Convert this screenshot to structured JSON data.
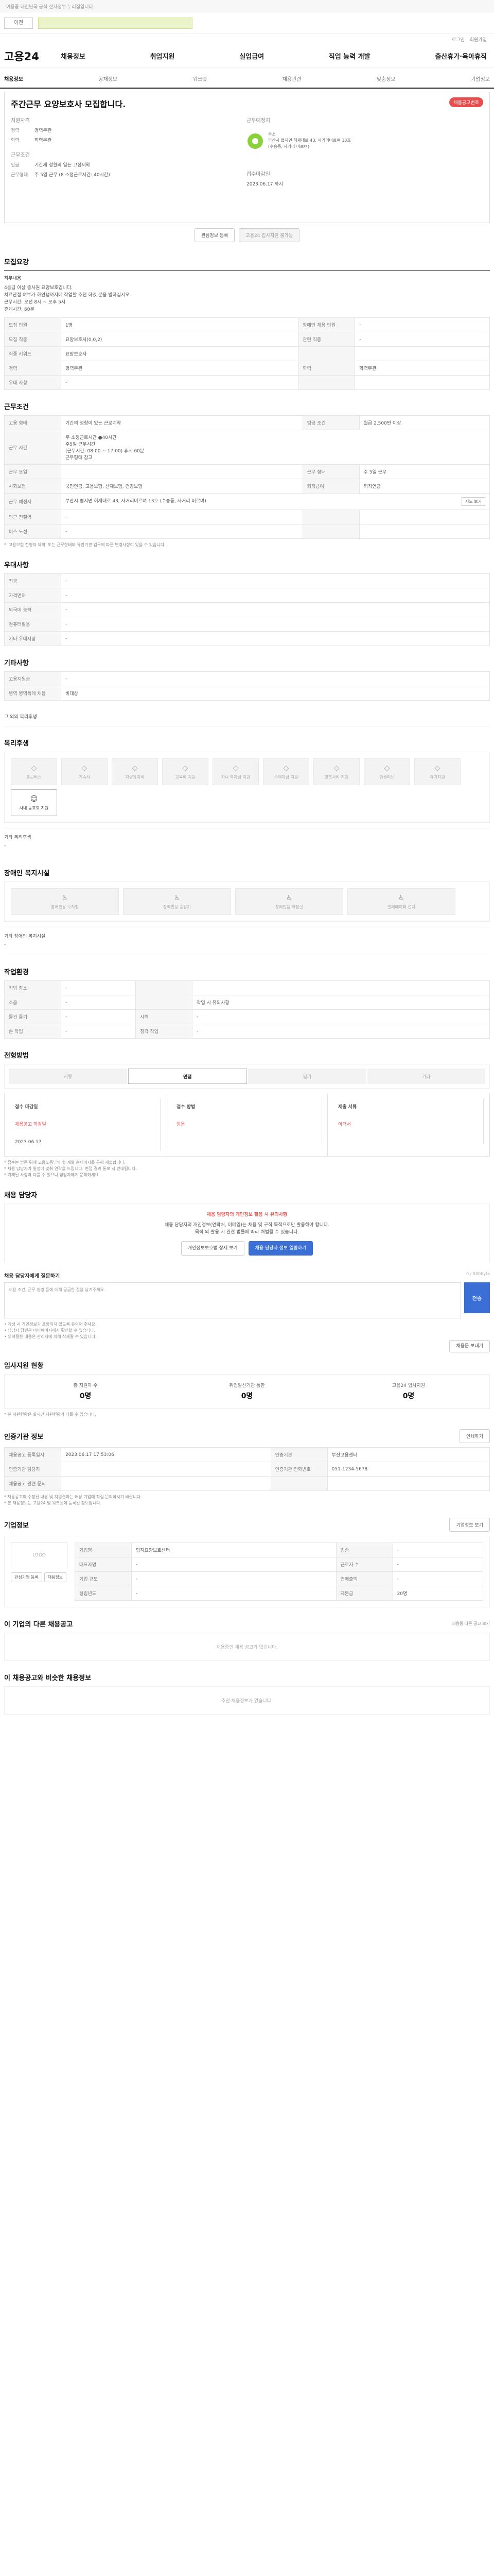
{
  "topbar": {
    "notice": "이용중 대한민국 공식 전자정부 누리집입니다."
  },
  "search": {
    "prev_label": "이전",
    "next_label": "다음"
  },
  "util": [
    "로그인",
    "회원가입"
  ],
  "brand": {
    "logo": "고용24"
  },
  "gnb": [
    "채용정보",
    "취업지원",
    "실업급여",
    "직업 능력 개발",
    "출산휴가·육아휴직"
  ],
  "lnb": [
    "채용정보",
    "공채정보",
    "워크넷",
    "채용관련",
    "맞춤정보",
    "기업정보"
  ],
  "summary": {
    "title": "주간근무 요양보호사 모집합니다.",
    "badge": "채용공고번호",
    "qual_h": "지원자격",
    "career_k": "경력",
    "career_v": "경력무관",
    "edu_k": "학력",
    "edu_v": "학력무관",
    "cond_h": "근무조건",
    "wage_k": "임금",
    "wage_v": "기간제 정월의 일는 고정제약",
    "hours_k": "근무형태",
    "hours_v": "주 5일 근무 (8 소정근로시간: 40시간)",
    "place_h": "근무예정지",
    "place_line1": "주소",
    "place_line2": "부산시 협지면 허제대로 43, 사거리버르며 13호",
    "place_line3": "(수송동, 사거리 버르며)",
    "period_h": "접수마감일",
    "period_v": "2023.06.17 까지"
  },
  "actions": {
    "interest": "관심정보 등록",
    "apply": "고용24 입사지원 불가능"
  },
  "recruit": {
    "h": "모집요강",
    "desc_title": "직무내용",
    "desc_lines": [
      "4등급 이상 종사원 요양보호입니다.",
      "치료단절 여부가 하얀탭까지에 작업할 추천 하였 분을 별하십시오.",
      "근무시간: 오전 8시 ~ 오후 5시",
      "휴게시간: 60분"
    ],
    "rows": [
      [
        "모집 인원",
        "1명",
        "장애인 채용 인원",
        "-"
      ],
      [
        "모집 직종",
        "요양보호사(0,0,2)",
        "관련 직종",
        "-"
      ],
      [
        "직종 키워드",
        "요양보호사",
        "",
        ""
      ],
      [
        "경력",
        "경력무관",
        "학력",
        "학력무관"
      ],
      [
        "우대 사항",
        "-",
        "",
        ""
      ]
    ]
  },
  "work": {
    "h": "근무조건",
    "rows": [
      [
        "고용 형태",
        "기간의 정함이 있는 근로계약",
        "임금 조건",
        "월급 2,500만 이상"
      ],
      [
        "근무 시간",
        "주 소정근로시간 ●40시간",
        "",
        ""
      ],
      [
        "근무 요일",
        "",
        "근무 형태",
        "주 5일 근무"
      ],
      [
        "사회보험",
        "국민연금, 고용보험, 산재보험, 건강보험",
        "퇴직급여",
        "퇴직연금"
      ],
      [
        "근무 예정지",
        "부산시 협지면 허제대로 43, 사거리버르며 13호 (수송동, 사거리 버르며)",
        "",
        ""
      ],
      [
        "인근 전철역",
        "-",
        "",
        ""
      ],
      [
        "버스 노선",
        "-",
        "",
        ""
      ]
    ],
    "time_lines": [
      "주5일 근무시간",
      "(근무시간: 08:00 ~ 17:00) 휴게 60분",
      "근무형태 참고"
    ],
    "map_btn": "지도 보기",
    "note": "* '고용보험 전형자 제외' 또는 근무형태와 유관기관 업무에 따른 변경사항이 있을 수 있습니다."
  },
  "pref": {
    "h": "우대사항",
    "rows": [
      [
        "전공",
        "-"
      ],
      [
        "자격면허",
        "-"
      ],
      [
        "외국어 능력",
        "-"
      ],
      [
        "컴퓨터활용",
        "-"
      ],
      [
        "기타 우대사항",
        "-"
      ]
    ]
  },
  "etc": {
    "h": "기타사항",
    "rows": [
      [
        "고용지원금",
        "-"
      ],
      [
        "병역 병역특례 채용",
        "비대상"
      ]
    ],
    "link": "그 외의 복리후생"
  },
  "welfare": {
    "h": "복리후생",
    "items": [
      "통근버스",
      "기숙사",
      "차량유지비",
      "교육비 지원",
      "자녀 학자금 지원",
      "주택자금 지원",
      "경조사비 지원",
      "인센티브",
      "휴가지원"
    ],
    "active": "사내 동호회 지원",
    "sub_h": "기타 복리후생",
    "sub_v": "-"
  },
  "disab": {
    "h": "장애인 복지시설",
    "items": [
      "장애인용 주차장",
      "장애인용 승강기",
      "장애인용 화장실",
      "엘레베이터 설치"
    ],
    "sub_h": "기타 장애인 복지시설",
    "sub_v": "-"
  },
  "env": {
    "h": "작업환경",
    "rows": [
      [
        "작업 장소",
        "-",
        "",
        ""
      ],
      [
        "소음",
        "-",
        "",
        "작업 시 유의사항"
      ],
      [
        "물건 들기",
        "-",
        "시력",
        "-"
      ],
      [
        "손 작업",
        "-",
        "청각 작업",
        "-"
      ]
    ]
  },
  "process": {
    "h": "전형방법",
    "tabs": [
      "서류",
      "면접",
      "필기",
      "기타"
    ],
    "active": 1,
    "steps": [
      [
        "접수 마감일",
        "채용공고 마감일",
        "2023.06.17"
      ],
      [
        "접수 방법",
        "방문",
        ""
      ],
      [
        "제출 서류",
        "이력서",
        ""
      ]
    ],
    "notes": [
      "* 접수는 방문 뒤에 고용노동부와 협 계열 홈페이지를 통해 제출합니다.",
      "* 채용 담당자가 일정에 맞춰 연락을 드립니다. 면접 결과 통보 시 안내됩니다.",
      "* 기재된 사항과 다를 수 있으니 담당자에게 문의하세요."
    ]
  },
  "contact": {
    "h": "채용 담당자",
    "warn": "채용 담당자의 개인정보 활용 시 유의사항",
    "line1": "채용 담당자의 개인정보(연락처, 이메일)는 채용 및 구직 목적으로만 활용해야 합니다.",
    "line2": "목적 외 활용 시 관련 법률에 따라 처벌될 수 있습니다.",
    "btn1": "개인정보보호법 상세 보기",
    "btn2": "채용 담당자 정보 열람하기",
    "ask_h": "채용 담당자에게 질문하기",
    "count": "0 / 500byte",
    "placeholder": "채용 조건, 근무 환경 등에 대해 궁금한 점을 남겨주세요.",
    "send": "전송",
    "tips": [
      "• 작성 시 개인정보가 포함되지 않도록 유의해 주세요.",
      "• 담당자 답변은 마이페이지에서 확인할 수 있습니다.",
      "• 부적절한 내용은 관리자에 의해 삭제될 수 있습니다."
    ],
    "help_btn": "채용문 보내기"
  },
  "apply_stats": {
    "h": "입사지원 현황",
    "items": [
      [
        "총 지원자 수",
        "0명"
      ],
      [
        "취업알선기관 통한",
        "0명"
      ],
      [
        "고용24 입사지원",
        "0명"
      ]
    ],
    "note": "* 본 지원현황은 실시간 지원현황과 다를 수 있습니다."
  },
  "agency": {
    "h": "인증기관 정보",
    "btn": "인쇄하기",
    "rows": [
      [
        "채용공고 등록일시",
        "2023.06.17 17:53:06",
        "인증기관",
        "부산고용센터"
      ],
      [
        "인증기관 담당자",
        "",
        "인증기관 전화번호",
        "051-1234-5678"
      ],
      [
        "채용공고 관련 문의",
        "",
        "",
        ""
      ]
    ],
    "notes": [
      "* 채용공고의 수정된 내용 및 지원결과는 해당 기업에 직접 문의하시기 바랍니다.",
      "* 본 채용정보는 고용24 및 워크넷에 등록된 정보입니다."
    ]
  },
  "company": {
    "h": "기업정보",
    "btn": "기업정보 보기",
    "logo": "LOGO",
    "rows": [
      [
        "기업명",
        "협지요양보호센터",
        "업종",
        "-"
      ],
      [
        "대표자명",
        "-",
        "근로자 수",
        "-"
      ],
      [
        "기업 규모",
        "-",
        "연매출액",
        "-"
      ],
      [
        "설립년도",
        "-",
        "자본금",
        "20명"
      ]
    ],
    "btns": [
      "관심기업 등록",
      "채용정보"
    ]
  },
  "other": {
    "h": "이 기업의 다른 채용공고",
    "right": "채용중 다른 공고 보기",
    "empty": "채용중인 채용 공고가 없습니다."
  },
  "recommend": {
    "h": "이 채용공고와 비슷한 채용정보",
    "empty": "추천 채용정보가 없습니다."
  }
}
